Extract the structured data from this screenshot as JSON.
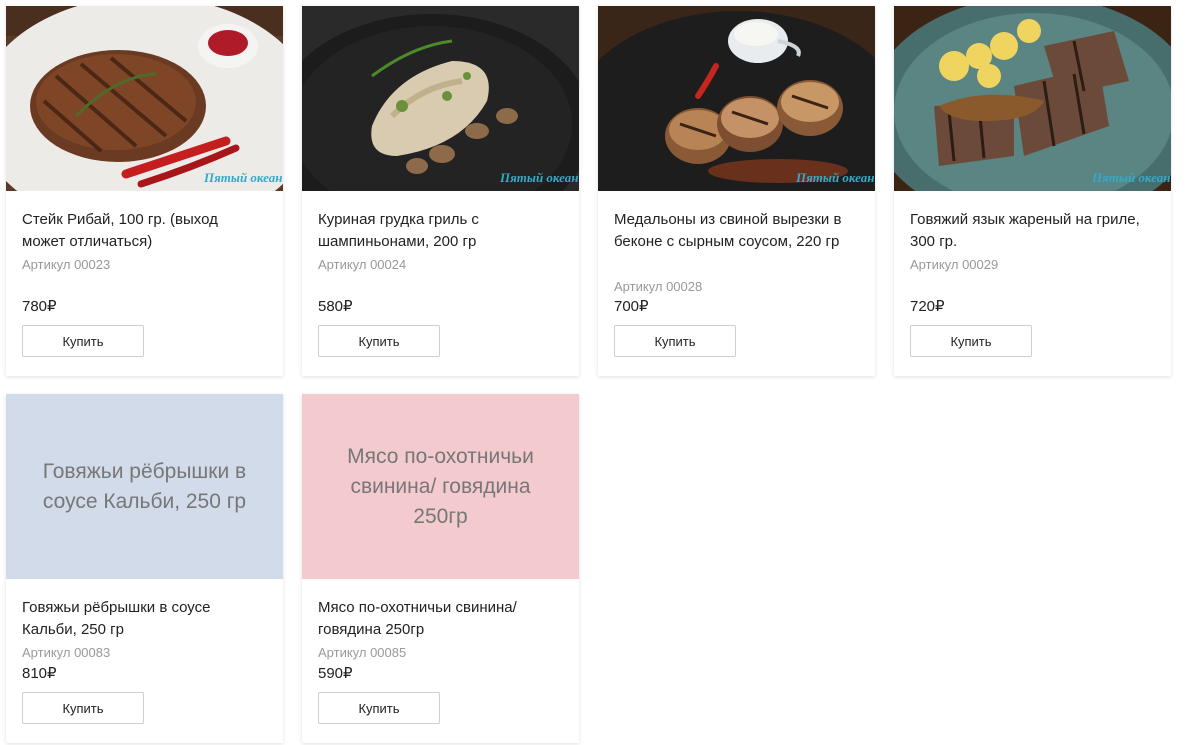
{
  "currency": "₽",
  "buy_label": "Купить",
  "logo_text": "Пятый океан",
  "products": [
    {
      "title": "Стейк Рибай, 100 гр. (выход может отличаться)",
      "sku": "Артикул 00023",
      "price": "780₽"
    },
    {
      "title": "Куриная грудка гриль с шампиньонами, 200 гр",
      "sku": "Артикул 00024",
      "price": "580₽"
    },
    {
      "title": "Медальоны из свиной вырезки в беконе с сырным соусом, 220 гр",
      "sku": "Артикул 00028",
      "price": "700₽"
    },
    {
      "title": "Говяжий язык жареный на гриле, 300 гр.",
      "sku": "Артикул 00029",
      "price": "720₽"
    },
    {
      "title": "Говяжьи рёбрышки в соусе Кальби, 250 гр",
      "sku": "Артикул 00083",
      "price": "810₽",
      "placeholder_text": "Говяжьи рёбрышки в соусе Кальби, 250 гр",
      "placeholder_color": "#d2dbea"
    },
    {
      "title": "Мясо по-охотничьи свинина/ говядина 250гр",
      "sku": "Артикул 00085",
      "price": "590₽",
      "placeholder_text": "Мясо по-охотничьи свинина/ говядина 250гр",
      "placeholder_color": "#f3cacd"
    }
  ]
}
